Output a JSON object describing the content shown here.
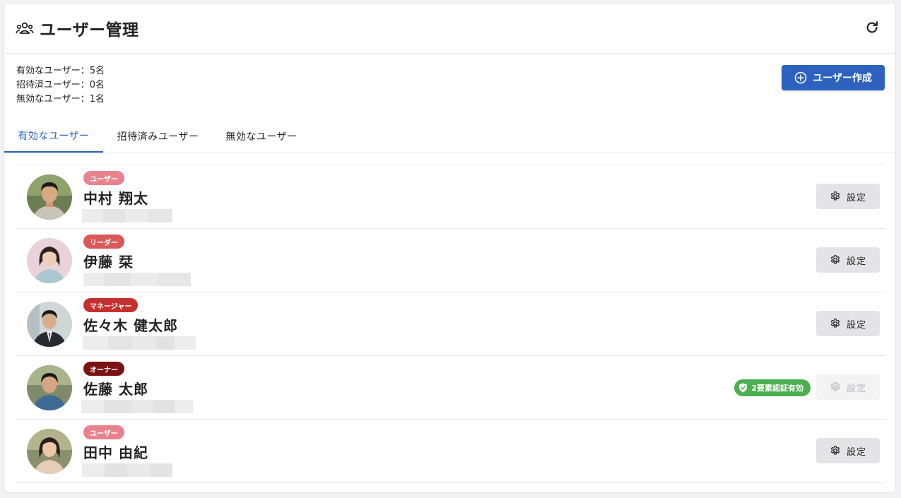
{
  "header": {
    "title": "ユーザー管理"
  },
  "stats": {
    "active": "有効なユーザー：5名",
    "invited": "招待済ユーザー：0名",
    "inactive": "無効なユーザー：1名"
  },
  "create_button": {
    "label": "ユーザー作成"
  },
  "tabs": [
    {
      "label": "有効なユーザー",
      "active": true
    },
    {
      "label": "招待済みユーザー",
      "active": false
    },
    {
      "label": "無効なユーザー",
      "active": false
    }
  ],
  "users": [
    {
      "role": "ユーザー",
      "role_color": "#e8838e",
      "name": "中村 翔太",
      "settings_label": "設定",
      "settings_enabled": true,
      "mfa": ""
    },
    {
      "role": "リーダー",
      "role_color": "#d95858",
      "name": "伊藤 栞",
      "settings_label": "設定",
      "settings_enabled": true,
      "mfa": ""
    },
    {
      "role": "マネージャー",
      "role_color": "#c62f2f",
      "name": "佐々木 健太郎",
      "settings_label": "設定",
      "settings_enabled": true,
      "mfa": ""
    },
    {
      "role": "オーナー",
      "role_color": "#7a1313",
      "name": "佐藤 太郎",
      "settings_label": "設定",
      "settings_enabled": false,
      "mfa": "2要素認証有効"
    },
    {
      "role": "ユーザー",
      "role_color": "#e8838e",
      "name": "田中 由紀",
      "settings_label": "設定",
      "settings_enabled": true,
      "mfa": ""
    }
  ],
  "colors": {
    "primary": "#2d62bf",
    "success": "#4caf50"
  },
  "icons": {
    "title": "group-icon",
    "refresh": "refresh-icon",
    "add": "add-circle-icon",
    "settings": "gear-icon",
    "mfa": "shield-check-icon"
  }
}
